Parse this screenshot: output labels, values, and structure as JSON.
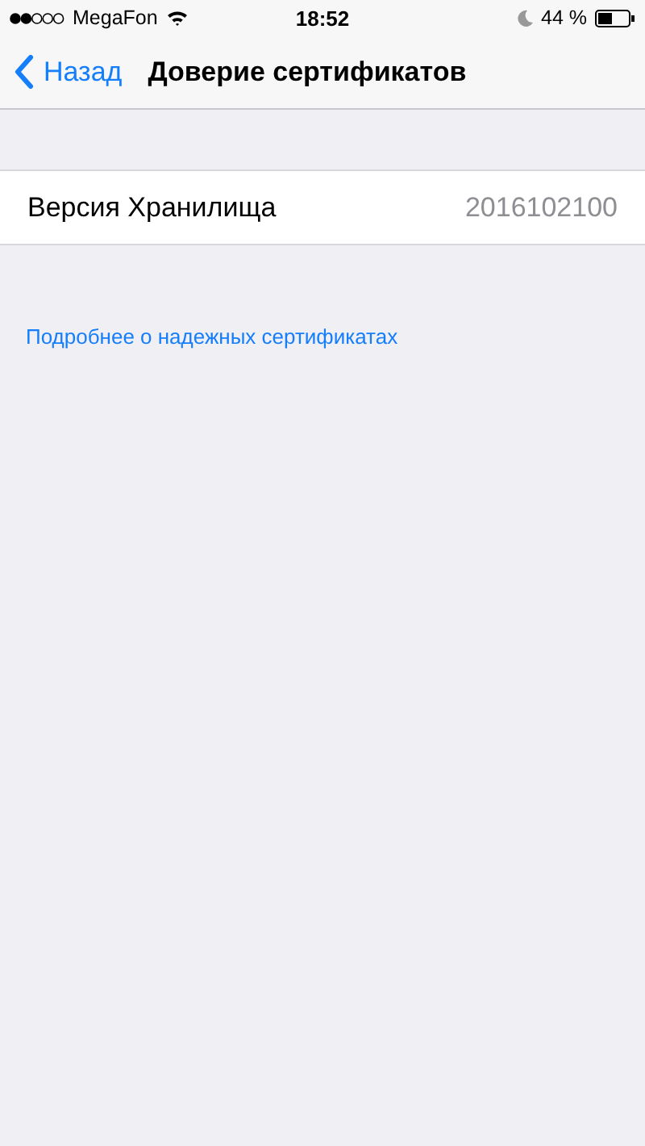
{
  "status_bar": {
    "carrier": "MegaFon",
    "time": "18:52",
    "battery": "44 %"
  },
  "nav": {
    "back": "Назад",
    "title": "Доверие сертификатов"
  },
  "rows": [
    {
      "label": "Версия Хранилища",
      "value": "2016102100"
    }
  ],
  "link": "Подробнее о надежных сертификатах"
}
